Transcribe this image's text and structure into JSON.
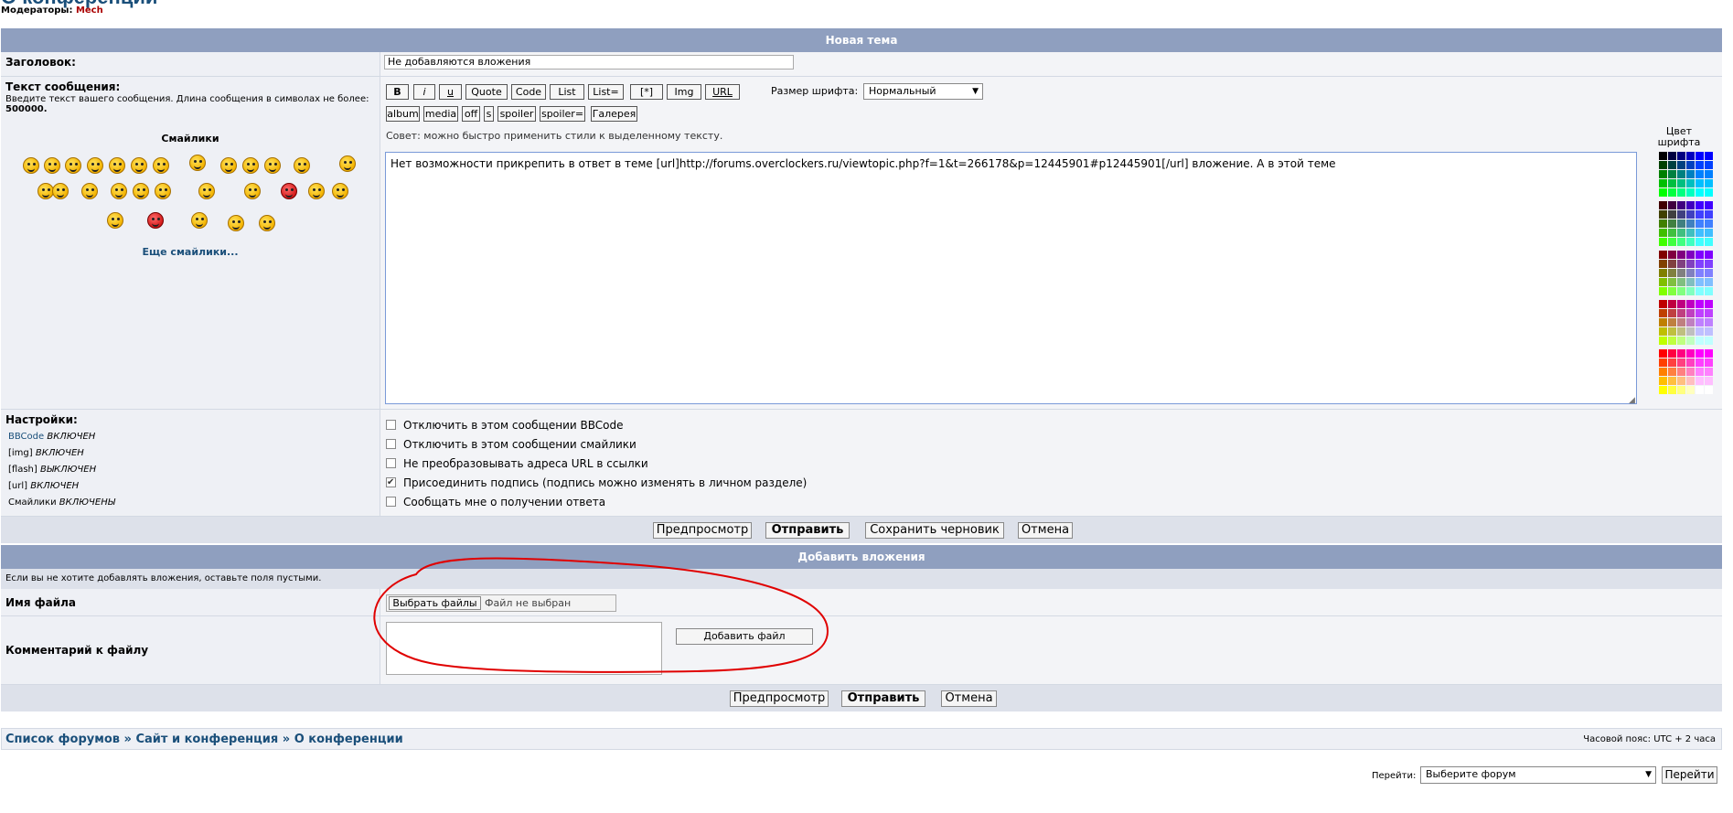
{
  "page": {
    "title": "О конференции",
    "moderators_label": "Модераторы:",
    "moderator": "Mech"
  },
  "new_topic": {
    "header": "Новая тема",
    "subject_label": "Заголовок:",
    "subject_value": "Не добавляются вложения",
    "message_label": "Текст сообщения:",
    "message_hint": "Введите текст вашего сообщения. Длина сообщения в символах не более:",
    "message_limit": "500000",
    "smilies_label": "Смайлики",
    "more_smilies": "Еще смайлики...",
    "bbcode_buttons": [
      "B",
      "i",
      "u",
      "Quote",
      "Code",
      "List",
      "List=",
      "[*]",
      "Img",
      "URL"
    ],
    "bbcode_buttons2": [
      "album",
      "media",
      "off",
      "s",
      "spoiler",
      "spoiler=",
      "Галерея"
    ],
    "font_size_label": "Размер шрифта:",
    "font_size_value": "Нормальный",
    "tip": "Совет: можно быстро применить стили к выделенному тексту.",
    "message_text": "Нет возможности прикрепить в ответ в теме  [url]http://forums.overclockers.ru/viewtopic.php?f=1&t=266178&p=12445901#p12445901[/url] вложение. А в этой теме",
    "color_label_1": "Цвет",
    "color_label_2": "шрифта"
  },
  "settings": {
    "label": "Настройки:",
    "status": [
      {
        "name": "BBCode",
        "state": "ВКЛЮЧЕН"
      },
      {
        "name": "[img]",
        "state": "ВКЛЮЧЕН"
      },
      {
        "name": "[flash]",
        "state": "ВЫКЛЮЧЕН"
      },
      {
        "name": "[url]",
        "state": "ВКЛЮЧЕН"
      },
      {
        "name": "Смайлики",
        "state": "ВКЛЮЧЕНЫ"
      }
    ],
    "options": [
      {
        "label": "Отключить в этом сообщении BBCode",
        "checked": false
      },
      {
        "label": "Отключить в этом сообщении смайлики",
        "checked": false
      },
      {
        "label": "Не преобразовывать адреса URL в ссылки",
        "checked": false
      },
      {
        "label": "Присоединить подпись (подпись можно изменять в личном разделе)",
        "checked": true
      },
      {
        "label": "Сообщать мне о получении ответа",
        "checked": false
      }
    ]
  },
  "actions": {
    "preview": "Предпросмотр",
    "submit": "Отправить",
    "save_draft": "Сохранить черновик",
    "cancel": "Отмена"
  },
  "attachments": {
    "header": "Добавить вложения",
    "hint": "Если вы не хотите добавлять вложения, оставьте поля пустыми.",
    "filename_label": "Имя файла",
    "choose_files": "Выбрать файлы",
    "no_file": "Файл не выбран",
    "comment_label": "Комментарий к файлу",
    "add_file": "Добавить файл"
  },
  "actions2": {
    "preview": "Предпросмотр",
    "submit": "Отправить",
    "cancel": "Отмена"
  },
  "breadcrumb": {
    "items": [
      "Список форумов",
      "Сайт и конференция",
      "О конференции"
    ],
    "separator": "»"
  },
  "timezone": "Часовой пояс: UTC + 2 часа",
  "jump": {
    "label": "Перейти:",
    "select_value": "Выберите форум",
    "button": "Перейти"
  },
  "colors": {
    "header_bg": "#8f9fbf",
    "link": "#1a4f7a",
    "annotation": "#e00000"
  }
}
